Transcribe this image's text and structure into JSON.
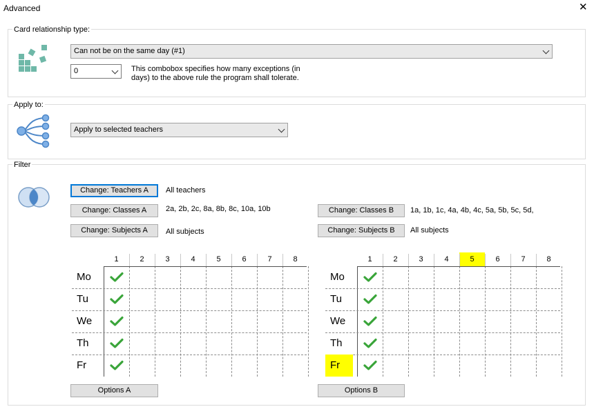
{
  "window": {
    "title": "Advanced",
    "close_icon": "close-icon"
  },
  "card_relationship": {
    "group_label": "Card relationship type:",
    "icon": "cards-relationship-icon",
    "type_value": "Can not be on the same day (#1)",
    "exceptions_value": "0",
    "exceptions_help_line1": "This combobox specifies how many exceptions (in",
    "exceptions_help_line2": "days) to the above rule the program shall tolerate."
  },
  "apply_to": {
    "group_label": "Apply to:",
    "icon": "tree-branch-icon",
    "value": "Apply to selected teachers"
  },
  "filter": {
    "group_label": "Filter",
    "icon": "venn-diagram-icon",
    "teachers_a_button": "Change: Teachers A",
    "teachers_a_value": "All teachers",
    "classes_a_button": "Change: Classes A",
    "classes_a_value": "2a, 2b, 2c, 8a, 8b, 8c, 10a, 10b",
    "subjects_a_button": "Change: Subjects A",
    "subjects_a_value": "All subjects",
    "classes_b_button": "Change: Classes B",
    "classes_b_value": "1a, 1b, 1c, 4a, 4b, 4c, 5a, 5b, 5c, 5d,",
    "subjects_b_button": "Change: Subjects B",
    "subjects_b_value": "All subjects",
    "options_a_button": "Options A",
    "options_b_button": "Options B"
  },
  "grid_a": {
    "periods": [
      "1",
      "2",
      "3",
      "4",
      "5",
      "6",
      "7",
      "8"
    ],
    "days": [
      "Mo",
      "Tu",
      "We",
      "Th",
      "Fr"
    ],
    "checked_period": 1,
    "highlight_period": null,
    "highlight_day": null
  },
  "grid_b": {
    "periods": [
      "1",
      "2",
      "3",
      "4",
      "5",
      "6",
      "7",
      "8"
    ],
    "days": [
      "Mo",
      "Tu",
      "We",
      "Th",
      "Fr"
    ],
    "checked_period": 1,
    "highlight_period": "5",
    "highlight_day": "Fr"
  },
  "colors": {
    "check": "#3aa53a",
    "highlight": "#ffff00",
    "accent": "#0078d7"
  }
}
